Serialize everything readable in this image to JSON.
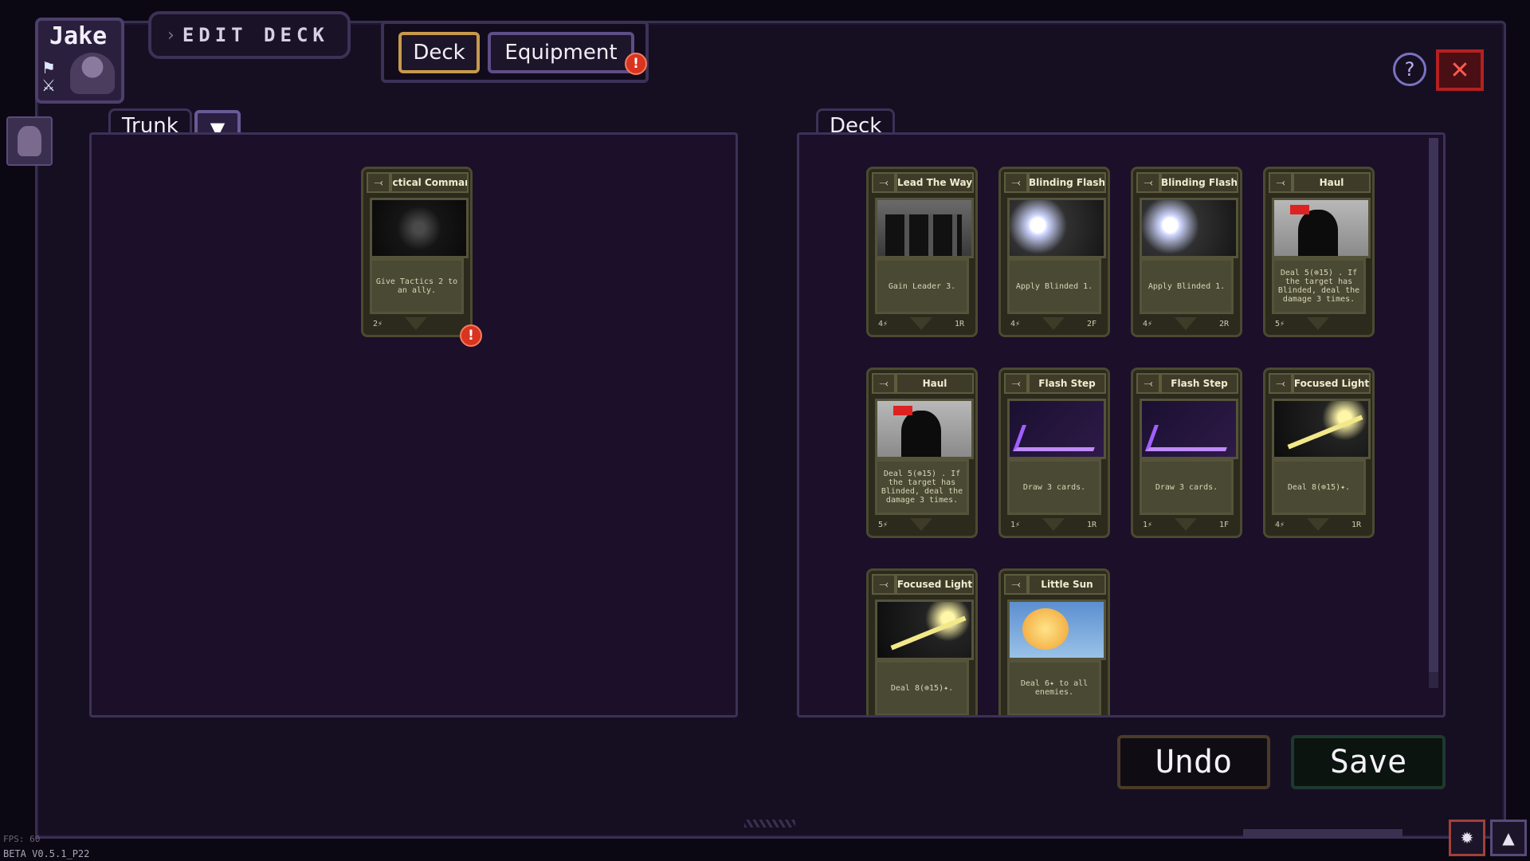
{
  "header": {
    "character_name": "Jake",
    "screen_title": "EDIT DECK",
    "tabs": [
      {
        "label": "Deck",
        "active": true
      },
      {
        "label": "Equipment",
        "active": false,
        "alert": "!"
      }
    ],
    "help_icon": "question-mark-icon",
    "close_icon": "close-x-icon"
  },
  "trunk": {
    "label": "Trunk",
    "filter_icon": "funnel-icon",
    "cards": [
      {
        "name": "Tactical Command",
        "art": "dark",
        "desc": "Give Tactics 2 to an ally.",
        "cost": "2⚡",
        "rarity": "",
        "alert": "!"
      }
    ]
  },
  "deck": {
    "label": "Deck",
    "cards": [
      {
        "name": "Lead The Way",
        "art": "silhouette",
        "desc": "Gain Leader 3.",
        "cost": "4⚡",
        "rarity": "1R"
      },
      {
        "name": "Blinding Flash",
        "art": "flash",
        "desc": "Apply Blinded 1.",
        "cost": "4⚡",
        "rarity": "2F"
      },
      {
        "name": "Blinding Flash",
        "art": "flash",
        "desc": "Apply Blinded 1.",
        "cost": "4⚡",
        "rarity": "2R"
      },
      {
        "name": "Haul",
        "art": "haul",
        "desc": "Deal 5(⊕15) . If the target has Blinded, deal the damage 3 times.",
        "cost": "5⚡",
        "rarity": ""
      },
      {
        "name": "Haul",
        "art": "haul",
        "desc": "Deal 5(⊕15) . If the target has Blinded, deal the damage 3 times.",
        "cost": "5⚡",
        "rarity": ""
      },
      {
        "name": "Flash Step",
        "art": "step",
        "desc": "Draw 3 cards.",
        "cost": "1⚡",
        "rarity": "1R"
      },
      {
        "name": "Flash Step",
        "art": "step",
        "desc": "Draw 3 cards.",
        "cost": "1⚡",
        "rarity": "1F"
      },
      {
        "name": "Focused Light",
        "art": "light",
        "desc": "Deal 8(⊕15)✦.",
        "cost": "4⚡",
        "rarity": "1R"
      },
      {
        "name": "Focused Light",
        "art": "light",
        "desc": "Deal 8(⊕15)✦.",
        "cost": "",
        "rarity": ""
      },
      {
        "name": "Little Sun",
        "art": "sun",
        "desc": "Deal 6✦ to all enemies.",
        "cost": "",
        "rarity": ""
      }
    ]
  },
  "actions": {
    "undo_label": "Undo",
    "save_label": "Save"
  },
  "footer": {
    "fps": "FPS: 60",
    "version": "BETA V0.5.1_P22"
  }
}
